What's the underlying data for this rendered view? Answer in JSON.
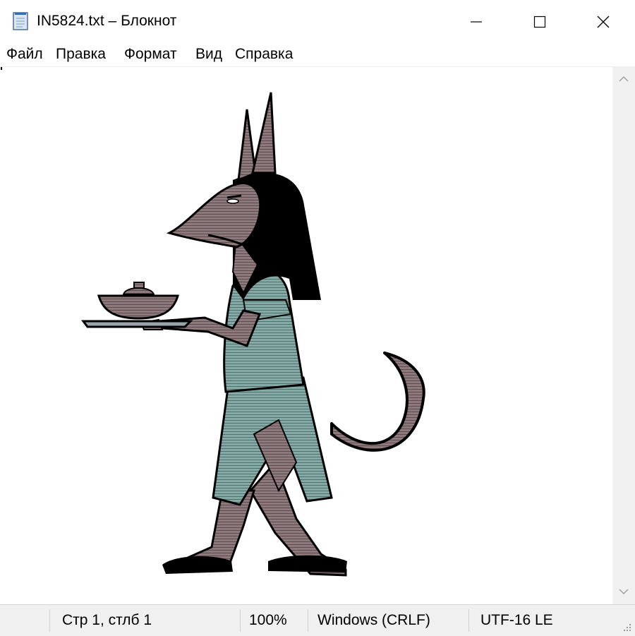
{
  "window": {
    "title": "IN5824.txt – Блокнот",
    "minimize_icon": "minimize-icon",
    "maximize_icon": "maximize-icon",
    "close_icon": "close-icon"
  },
  "menu": {
    "items": [
      "Файл",
      "Правка",
      "Формат",
      "Вид",
      "Справка"
    ]
  },
  "status": {
    "position": "Стр 1, стлб 1",
    "zoom": "100%",
    "line_endings": "Windows (CRLF)",
    "encoding": "UTF-16 LE"
  },
  "colors": {
    "skin": "#8e7a7d",
    "tunic": "#86aaa6",
    "hair": "#000000",
    "accent_bg": "#f0f0f0"
  }
}
